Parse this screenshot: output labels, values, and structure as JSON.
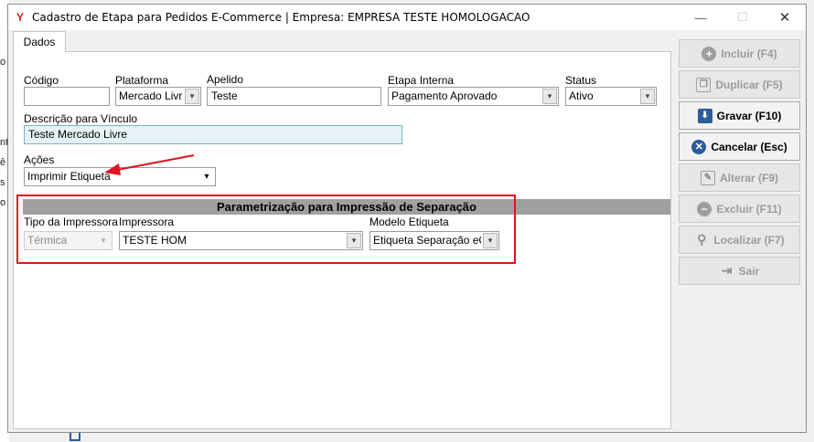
{
  "window": {
    "title": "Cadastro de Etapa para Pedidos E-Commerce | Empresa: EMPRESA TESTE HOMOLOGACAO",
    "app_icon_glyph": "Y",
    "minimize_glyph": "—",
    "maximize_glyph": "☐",
    "close_glyph": "✕"
  },
  "background": {
    "fragments": [
      "o",
      "nt",
      "ê",
      "s l",
      "o"
    ]
  },
  "tab": {
    "label": "Dados"
  },
  "form": {
    "codigo": {
      "label": "Código",
      "value": ""
    },
    "plataforma": {
      "label": "Plataforma",
      "value": "Mercado Livre"
    },
    "apelido": {
      "label": "Apelido",
      "value": "Teste"
    },
    "etapa_interna": {
      "label": "Etapa Interna",
      "value": "Pagamento Aprovado"
    },
    "status": {
      "label": "Status",
      "value": "Ativo"
    },
    "descricao": {
      "label": "Descrição para Vínculo",
      "value": "Teste Mercado Livre"
    },
    "acoes": {
      "label": "Ações",
      "value": "Imprimir Etiqueta"
    }
  },
  "section": {
    "title": "Parametrização para Impressão de Separação",
    "tipo_impressora": {
      "label": "Tipo da Impressora",
      "value": "Térmica"
    },
    "impressora": {
      "label": "Impressora",
      "value": "TESTE HOM"
    },
    "modelo_etiqueta": {
      "label": "Modelo Etiqueta",
      "value": "Etiqueta Separação eCom"
    }
  },
  "dropdown_glyph": "▾",
  "actions": [
    {
      "label": "Incluir (F4)",
      "icon": "+",
      "enabled": false
    },
    {
      "label": "Duplicar (F5)",
      "icon": "❐",
      "enabled": false
    },
    {
      "label": "Gravar (F10)",
      "icon": "⬇",
      "enabled": true
    },
    {
      "label": "Cancelar (Esc)",
      "icon": "✕",
      "enabled": true
    },
    {
      "label": "Alterar (F9)",
      "icon": "✎",
      "enabled": false
    },
    {
      "label": "Excluir (F11)",
      "icon": "−",
      "enabled": false
    },
    {
      "label": "Localizar (F7)",
      "icon": "⚲",
      "enabled": false
    },
    {
      "label": "Sair",
      "icon": "⇥",
      "enabled": false
    }
  ],
  "colors": {
    "annotation_red": "#e0141e",
    "accent_blue": "#2a5c9c"
  }
}
